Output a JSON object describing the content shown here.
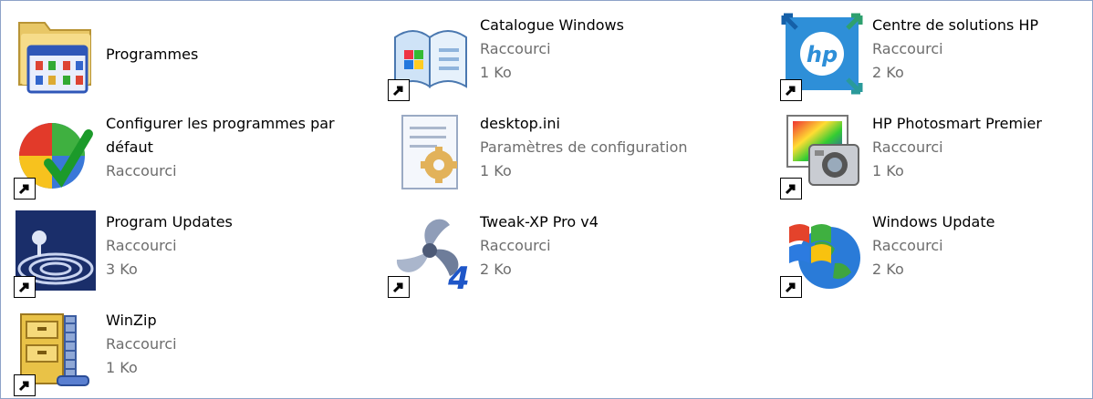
{
  "items": [
    {
      "name": "Programmes",
      "line2": "",
      "line3": ""
    },
    {
      "name": "Catalogue Windows",
      "line2": "Raccourci",
      "line3": "1 Ko"
    },
    {
      "name": "Centre de solutions HP",
      "line2": "Raccourci",
      "line3": "2 Ko"
    },
    {
      "name": "Configurer les programmes par défaut",
      "line2": "Raccourci",
      "line3": ""
    },
    {
      "name": "desktop.ini",
      "line2": "Paramètres de configuration",
      "line3": "1 Ko"
    },
    {
      "name": "HP Photosmart Premier",
      "line2": "Raccourci",
      "line3": "1 Ko"
    },
    {
      "name": "Program Updates",
      "line2": "Raccourci",
      "line3": "3 Ko"
    },
    {
      "name": "Tweak-XP Pro v4",
      "line2": "Raccourci",
      "line3": "2 Ko"
    },
    {
      "name": "Windows Update",
      "line2": "Raccourci",
      "line3": "2 Ko"
    },
    {
      "name": "WinZip",
      "line2": "Raccourci",
      "line3": "1 Ko"
    }
  ],
  "icons": [
    "folder-programs-icon",
    "catalogue-book-icon",
    "hp-logo-icon",
    "colorful-check-icon",
    "ini-file-gear-icon",
    "camera-photo-icon",
    "update-disc-icon",
    "tweak-fan-icon",
    "windows-globe-icon",
    "winzip-cabinet-icon"
  ]
}
